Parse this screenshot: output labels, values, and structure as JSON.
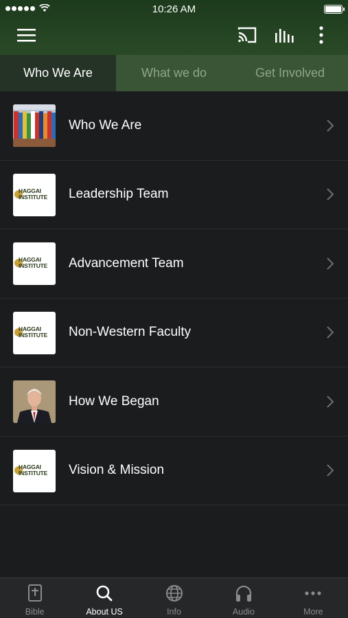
{
  "status_bar": {
    "time": "10:26 AM"
  },
  "tabs": [
    {
      "label": "Who We Are"
    },
    {
      "label": "What we do"
    },
    {
      "label": "Get Involved"
    }
  ],
  "list": [
    {
      "label": "Who We Are",
      "thumb": "flags-photo"
    },
    {
      "label": "Leadership Team",
      "thumb": "haggai-logo"
    },
    {
      "label": "Advancement Team",
      "thumb": "haggai-logo"
    },
    {
      "label": "Non-Western Faculty",
      "thumb": "haggai-logo"
    },
    {
      "label": "How We Began",
      "thumb": "founder-photo"
    },
    {
      "label": "Vision & Mission",
      "thumb": "haggai-logo"
    }
  ],
  "logo_text": {
    "line1": "HAGGAI",
    "line2": "INSTITUTE"
  },
  "bottom_tabs": [
    {
      "label": "Bible",
      "icon": "bible-icon"
    },
    {
      "label": "About US",
      "icon": "search-icon"
    },
    {
      "label": "Info",
      "icon": "globe-icon"
    },
    {
      "label": "Audio",
      "icon": "headphones-icon"
    },
    {
      "label": "More",
      "icon": "more-dots-icon"
    }
  ],
  "colors": {
    "header": "#2a4a27",
    "tab_active": "#253326",
    "tab_inactive": "#3a5436",
    "background": "#1b1c1e"
  }
}
